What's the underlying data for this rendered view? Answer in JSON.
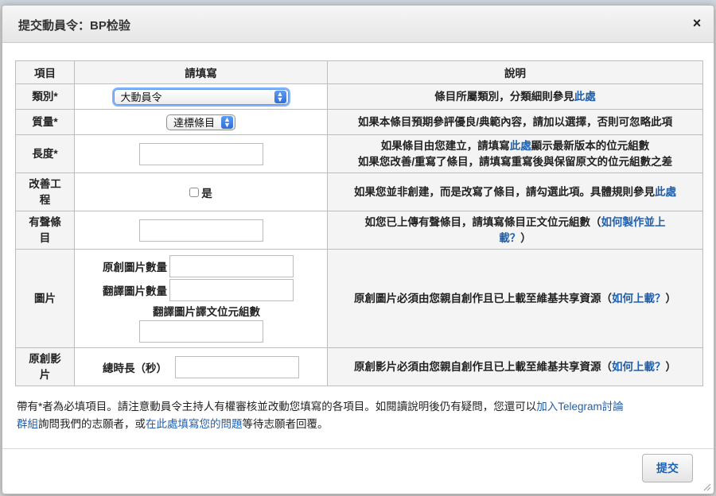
{
  "dialog": {
    "title": "提交動員令：BP检验",
    "close_label": "×"
  },
  "table": {
    "headers": [
      "項目",
      "請填寫",
      "說明"
    ],
    "rows": {
      "category": {
        "label": "類別*",
        "select_value": "大動員令",
        "desc_prefix": "條目所屬類別，分類細則參見",
        "desc_link": "此處"
      },
      "quality": {
        "label": "質量*",
        "select_value": "達標條目",
        "desc": "如果本條目預期參評優良/典範內容，請加以選擇，否則可忽略此項"
      },
      "length": {
        "label": "長度*",
        "desc_line1_prefix": "如果條目由您建立，請填寫",
        "desc_line1_link": "此處",
        "desc_line1_suffix": "顯示最新版本的位元組數",
        "desc_line2": "如果您改善/重寫了條目，請填寫重寫後與保留原文的位元組數之差"
      },
      "improve": {
        "label_line1": "改善工",
        "label_line2": "程",
        "checkbox_label": "是",
        "checked": false,
        "desc_prefix": "如果您並非創建，而是改寫了條目，請勾選此項。具體規則參見",
        "desc_link": "此處"
      },
      "audio": {
        "label_line1": "有聲條",
        "label_line2": "目",
        "desc_line1_prefix": "如您已上傳有聲條目，請填寫條目正文位元組數（",
        "desc_line1_link": "如何製作並上",
        "desc_line2_link": "載？",
        "desc_line2_suffix": "）"
      },
      "images": {
        "label": "圖片",
        "original_count_label": "原創圖片數量",
        "translated_count_label": "翻譯圖片數量",
        "translated_bytes_label": "翻譯圖片譯文位元組數",
        "desc_prefix": "原創圖片必須由您親自創作且已上載至維基共享資源（",
        "desc_link": "如何上載？",
        "desc_suffix": "）"
      },
      "video": {
        "label_line1": "原創影",
        "label_line2": "片",
        "duration_label": "總時長（秒）",
        "desc_prefix": "原創影片必須由您親自創作且已上載至維基共享資源（",
        "desc_link": "如何上載？",
        "desc_suffix": "）"
      }
    }
  },
  "footer": {
    "text1": "帶有*者為必填項目。請注意動員令主持人有權審核並改動您填寫的各項目。如閱讀說明後仍有疑問，您還可以",
    "link1_part1": "加入Telegram討論",
    "link1_part2": "群組",
    "text2": "詢問我們的志願者，或",
    "link2": "在此處填寫您的問題",
    "text3": "等待志願者回覆。"
  },
  "submit_label": "提交",
  "colors": {
    "link": "#1f5fae",
    "select_accent": "#2f6ed8",
    "label_bg": "#f4f4f4"
  }
}
